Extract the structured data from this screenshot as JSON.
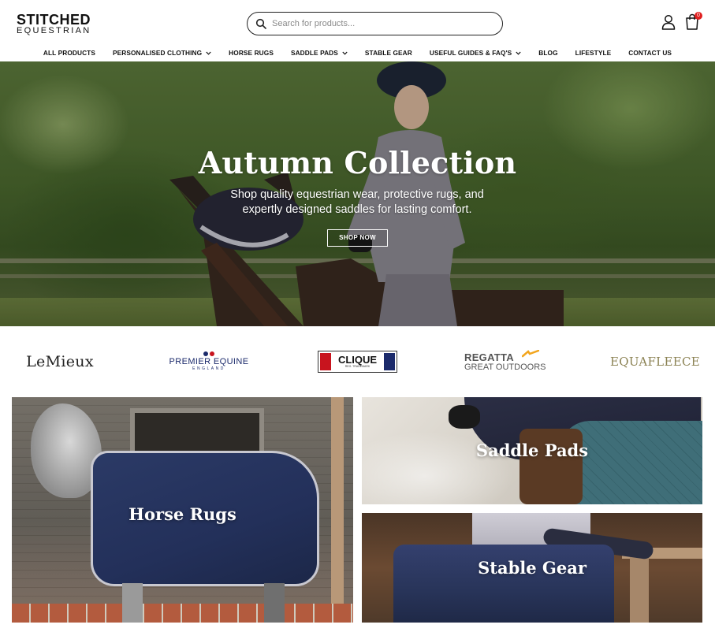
{
  "header": {
    "logo_main": "STITCHED",
    "logo_sub": "EQUESTRIAN",
    "search_placeholder": "Search for products...",
    "cart_count": "0"
  },
  "nav": {
    "items": [
      {
        "label": "ALL PRODUCTS",
        "has_dropdown": false
      },
      {
        "label": "PERSONALISED CLOTHING",
        "has_dropdown": true
      },
      {
        "label": "HORSE RUGS",
        "has_dropdown": false
      },
      {
        "label": "SADDLE PADS",
        "has_dropdown": true
      },
      {
        "label": "STABLE GEAR",
        "has_dropdown": false
      },
      {
        "label": "USEFUL GUIDES & FAQ'S",
        "has_dropdown": true
      },
      {
        "label": "BLOG",
        "has_dropdown": false
      },
      {
        "label": "LIFESTYLE",
        "has_dropdown": false
      },
      {
        "label": "CONTACT US",
        "has_dropdown": false
      }
    ]
  },
  "hero": {
    "title": "Autumn Collection",
    "subtitle": "Shop quality equestrian wear, protective rugs, and expertly designed saddles for lasting comfort.",
    "cta_label": "SHOP NOW"
  },
  "brands": {
    "lemieux": "LeMieux",
    "premier_name": "PREMIER EQUINE",
    "premier_country": "ENGLAND",
    "clique_name": "CLIQUE",
    "clique_tm": "REG. TRADEMARK",
    "regatta_line1": "REGATTA",
    "regatta_line2": "GREAT OUTDOORS",
    "equafleece": "EQUAFLEECE"
  },
  "categories": {
    "horse_rugs": "Horse Rugs",
    "saddle_pads": "Saddle Pads",
    "stable_gear": "Stable Gear"
  },
  "colors": {
    "badge": "#e02020",
    "clique_red": "#c8141e",
    "navy": "#1b2a6b",
    "equafleece": "#8b8253"
  }
}
